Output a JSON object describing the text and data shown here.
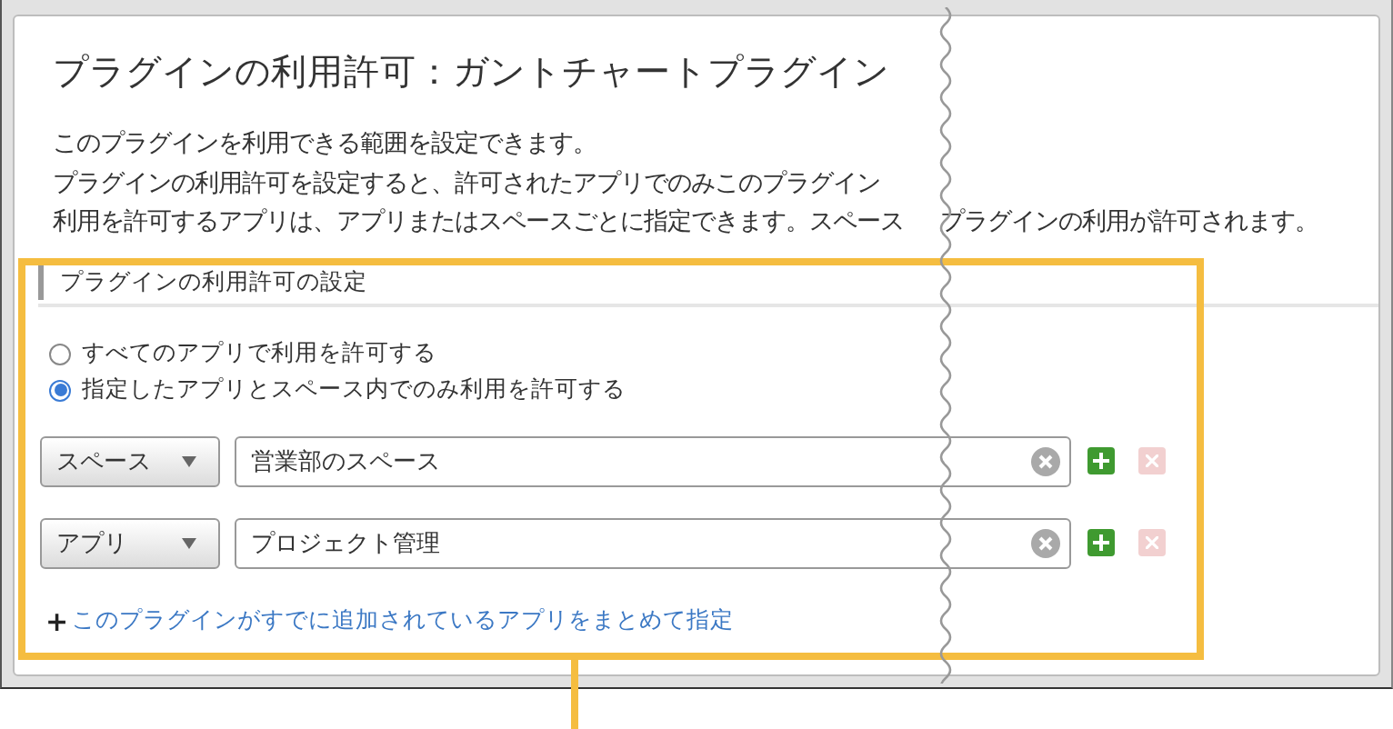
{
  "dialog": {
    "title": "プラグインの利用許可：ガントチャートプラグイン",
    "description_lines": [
      [
        "このプラグインを利用できる範囲を設定できます。"
      ],
      [
        "プラグインの利用許可を設定すると、許可されたアプリでのみこのプラグイン"
      ],
      [
        "利用を許可するアプリは、アプリまたはスペースごとに指定できます。スペース",
        "プラグインの利用が許可されます。"
      ]
    ],
    "section": {
      "title": "プラグインの利用許可の設定",
      "options": [
        {
          "label": "すべてのアプリで利用を許可する",
          "selected": false
        },
        {
          "label": "指定したアプリとスペース内でのみ利用を許可する",
          "selected": true
        }
      ],
      "rules": [
        {
          "type": "スペース",
          "value": "営業部のスペース",
          "remove_disabled": true
        },
        {
          "type": "アプリ",
          "value": "プロジェクト管理",
          "remove_disabled": true
        }
      ],
      "link": {
        "icon": "+",
        "label": "このプラグインがすでに追加されているアプリをまとめて指定"
      }
    }
  }
}
